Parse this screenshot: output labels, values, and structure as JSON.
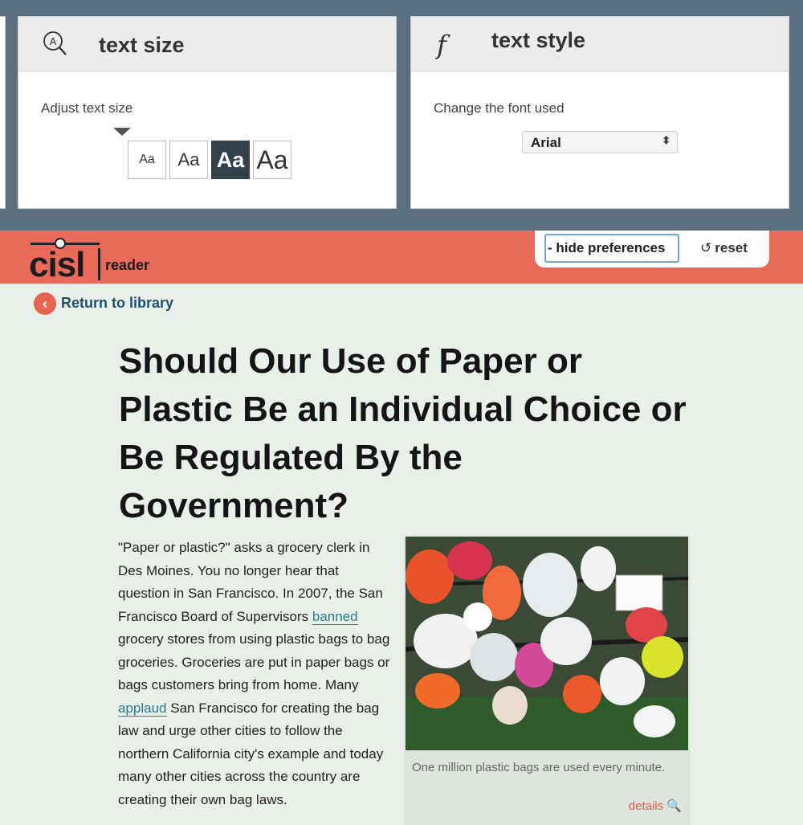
{
  "preferences": {
    "text_size": {
      "title": "text size",
      "icon": "magnifier-a-icon",
      "label": "Adjust text size",
      "options": [
        "Aa",
        "Aa",
        "Aa",
        "Aa"
      ],
      "selected_index": 2
    },
    "text_style": {
      "title": "text style",
      "icon_glyph": "f",
      "label": "Change the font used",
      "font_value": "Arial",
      "select_arrow": "⬍"
    }
  },
  "header": {
    "logo": "cisl",
    "logo_sub": "reader",
    "hide_label": "- hide preferences",
    "reset_label": "reset",
    "reset_icon": "↺"
  },
  "nav": {
    "back_icon": "‹",
    "back_label": "Return to library"
  },
  "article": {
    "title": "Should Our Use of Paper or Plastic Be an Individual Choice or Be Regulated By the Government?",
    "body": {
      "p1": "\"Paper or plastic?\" asks a grocery clerk in Des Moines. You no longer hear that question in San Francisco. In 2007, the San Francisco Board of Supervisors ",
      "link1": "banned",
      "p2": " grocery stores from using plastic bags to bag groceries. Groceries are put in paper bags or bags customers bring from home. Many ",
      "link2": "applaud",
      "p3": " San Francisco for creating the bag law and urge other cities to follow the northern California city's example and today many other cities across the country are creating their own bag laws."
    },
    "figure": {
      "caption": "One million plastic bags are used every minute.",
      "details_label": "details",
      "details_icon": "🔍"
    }
  },
  "colors": {
    "prefs_bg": "#5b6f7f",
    "accent": "#ea6a59",
    "link": "#2a7a8a",
    "selected": "#34414d"
  }
}
